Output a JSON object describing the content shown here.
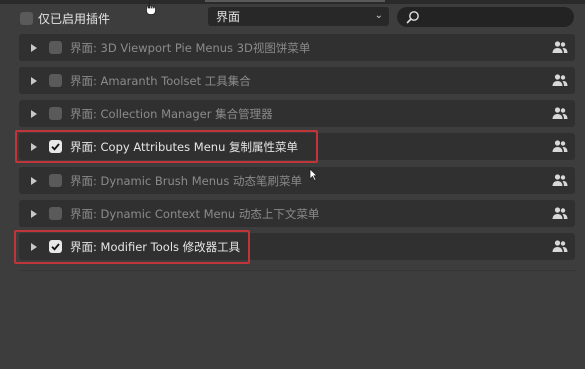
{
  "filter": {
    "enabled_only_label": "仅已启用插件",
    "checked": false
  },
  "category": {
    "value": "界面"
  },
  "search": {
    "icon": "search-icon",
    "value": ""
  },
  "addons": [
    {
      "label": "界面: 3D Viewport Pie Menus  3D视图饼菜单",
      "enabled": false
    },
    {
      "label": "界面: Amaranth Toolset  工具集合",
      "enabled": false
    },
    {
      "label": "界面: Collection Manager  集合管理器",
      "enabled": false
    },
    {
      "label": "界面: Copy Attributes Menu  复制属性菜单",
      "enabled": true,
      "highlighted": true
    },
    {
      "label": "界面: Dynamic Brush Menus  动态笔刷菜单",
      "enabled": false
    },
    {
      "label": "界面: Dynamic Context Menu  动态上下文菜单",
      "enabled": false
    },
    {
      "label": "界面: Modifier Tools  修改器工具",
      "enabled": true,
      "highlighted": true
    }
  ],
  "colors": {
    "background": "#3d3d3d",
    "row": "#303030",
    "highlight": "#c0353a",
    "checkbox_on": "#e8e8e8"
  }
}
